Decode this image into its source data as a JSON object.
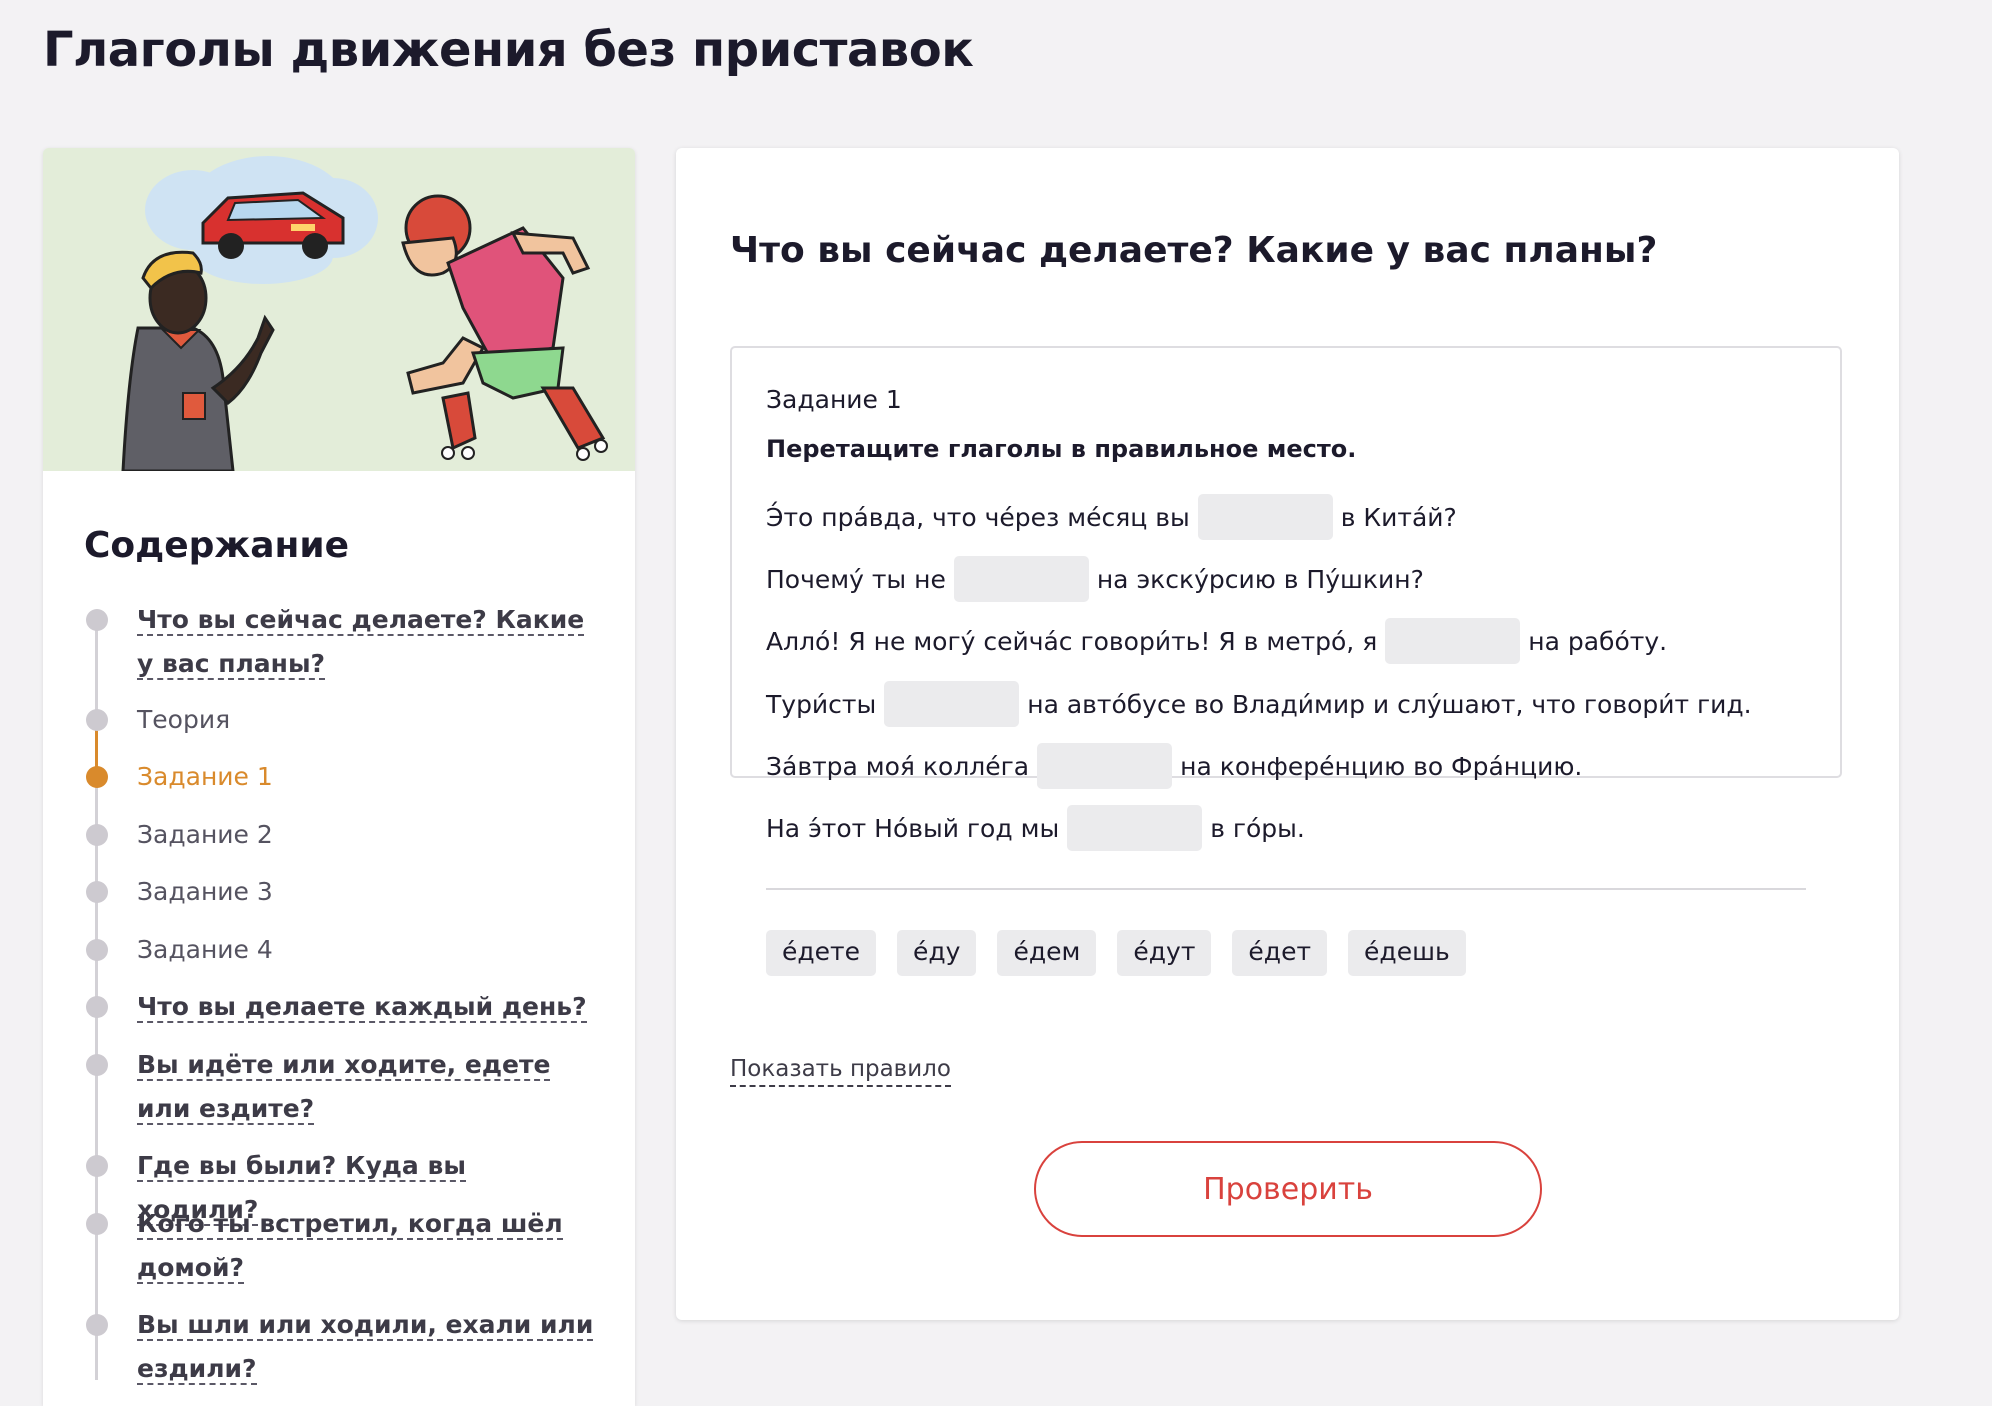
{
  "page": {
    "title": "Глаголы движения без приставок"
  },
  "sidebar": {
    "toc_heading": "Содержание",
    "items": [
      {
        "label": "Что вы сейчас делаете? Какие у вас планы?",
        "style": "link"
      },
      {
        "label": "Теория",
        "style": "plain"
      },
      {
        "label": "Задание 1",
        "style": "plain",
        "active": true
      },
      {
        "label": "Задание 2",
        "style": "plain"
      },
      {
        "label": "Задание 3",
        "style": "plain"
      },
      {
        "label": "Задание 4",
        "style": "plain"
      },
      {
        "label": "Что вы делаете каждый день?",
        "style": "link"
      },
      {
        "label": "Вы идёте или ходите, едете или ездите?",
        "style": "link"
      },
      {
        "label": "Где вы были? Куда вы ходили?",
        "style": "link"
      },
      {
        "label": "Кого ты встретил, когда шёл домой?",
        "style": "link"
      },
      {
        "label": "Вы шли или ходили, ехали или ездили?",
        "style": "link"
      }
    ]
  },
  "main": {
    "title": "Что вы сейчас делаете? Какие у вас планы?",
    "task": {
      "label": "Задание 1",
      "instruction": "Перетащите глаголы в правильное место.",
      "sentences": [
        {
          "before": "Э́то пра́вда, что че́рез ме́сяц вы",
          "after": "в Кита́й?"
        },
        {
          "before": "Почему́ ты не",
          "after": "на экску́рсию в Пу́шкин?"
        },
        {
          "before": "Алло́! Я не могу́ сейча́с говори́ть! Я в метро́, я",
          "after": "на рабо́ту."
        },
        {
          "before": "Тури́сты",
          "after": "на авто́бусе во Влади́мир и слу́шают, что говори́т гид."
        },
        {
          "before": "За́втра моя́ колле́га",
          "after": "на конфере́нцию во Фра́нцию."
        },
        {
          "before": "На э́тот Но́вый год мы",
          "after": "в го́ры."
        }
      ],
      "options": [
        "е́дете",
        "е́ду",
        "е́дем",
        "е́дут",
        "е́дет",
        "е́дешь"
      ]
    },
    "show_rule": "Показать правило",
    "check_button": "Проверить"
  },
  "colors": {
    "accent": "#d98a2c",
    "button": "#d9423d",
    "background": "#f3f2f4"
  }
}
